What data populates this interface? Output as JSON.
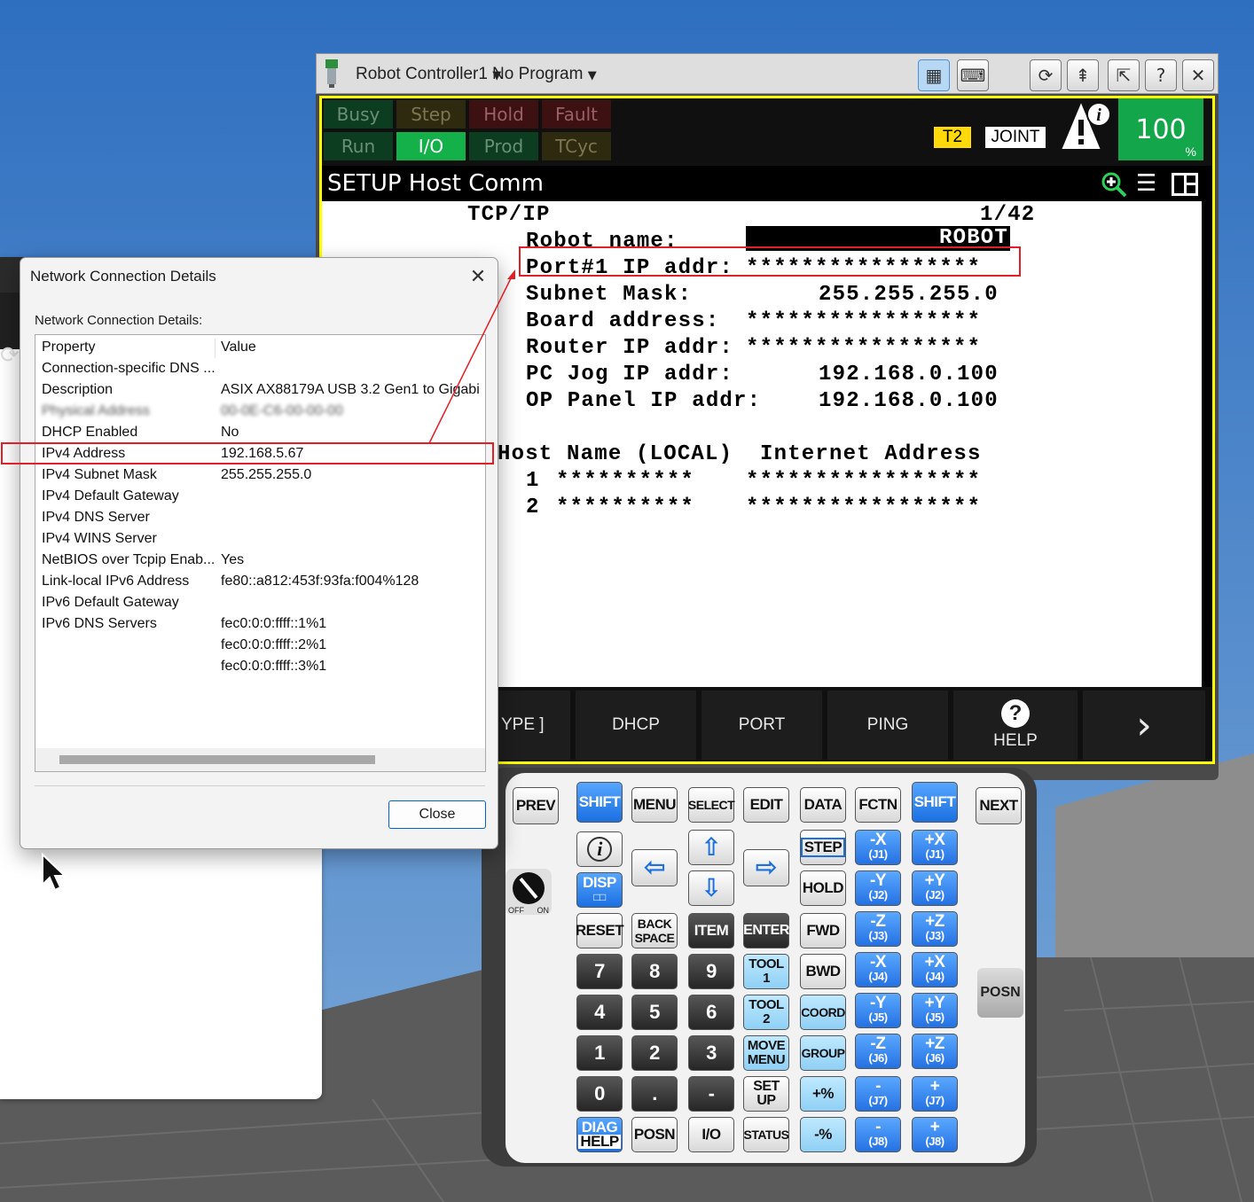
{
  "pendant": {
    "title_bar": {
      "controller_name": "Robot Controller1",
      "program_name": "No Program"
    },
    "status_leds": {
      "row1": [
        {
          "label": "Busy",
          "color": "green",
          "on": false
        },
        {
          "label": "Step",
          "color": "yellow",
          "on": false
        },
        {
          "label": "Hold",
          "color": "red",
          "on": false
        },
        {
          "label": "Fault",
          "color": "red",
          "on": false
        }
      ],
      "row2": [
        {
          "label": "Run",
          "color": "green",
          "on": false
        },
        {
          "label": "I/O",
          "color": "green",
          "on": true
        },
        {
          "label": "Prod",
          "color": "green",
          "on": false
        },
        {
          "label": "TCyc",
          "color": "yellow",
          "on": false
        }
      ]
    },
    "mode": "T2",
    "coord": "JOINT",
    "override": {
      "value": "100",
      "unit": "%"
    },
    "screen_title": "SETUP Host Comm",
    "content": {
      "section": "TCP/IP",
      "page": "1/42",
      "robot_name_label": "Robot name:",
      "robot_name_value": "ROBOT",
      "port1_label": "Port#1 IP addr:",
      "port1_value": "*****************",
      "subnet_label": "Subnet Mask:",
      "subnet_value": "255.255.255.0",
      "board_label": "Board address:",
      "board_value": "*****************",
      "router_label": "Router IP addr:",
      "router_value": "*****************",
      "pcjog_label": "PC Jog IP addr:",
      "pcjog_value": "192.168.0.100",
      "oppanel_label": "OP Panel IP addr:",
      "oppanel_value": "192.168.0.100",
      "host_header_name": "Host Name (LOCAL)",
      "host_header_addr": "Internet Address",
      "hosts": [
        {
          "num": "1",
          "name": "**********",
          "addr": "*****************"
        },
        {
          "num": "2",
          "name": "**********",
          "addr": "*****************"
        }
      ]
    },
    "function_keys": [
      "YPE ]",
      "DHCP",
      "PORT",
      "PING",
      "HELP"
    ],
    "keypad": {
      "prev": "PREV",
      "shift": "SHIFT",
      "menu": "MENU",
      "select": "SELECT",
      "edit": "EDIT",
      "data": "DATA",
      "fctn": "FCTN",
      "next": "NEXT",
      "disp": "DISP",
      "reset": "RESET",
      "back": "BACK",
      "space": "SPACE",
      "item": "ITEM",
      "enter": "ENTER",
      "step": "STEP",
      "hold": "HOLD",
      "fwd": "FWD",
      "bwd": "BWD",
      "coord": "COORD",
      "group": "GROUP",
      "tool": "TOOL",
      "move": "MOVE",
      "menu2": "MENU",
      "set": "SET",
      "up": "UP",
      "diag": "DIAG",
      "help": "HELP",
      "posn": "POSN",
      "io": "I/O",
      "status": "STATUS",
      "plus_pct": "+%",
      "minus_pct": "-%",
      "digits": [
        "7",
        "8",
        "9",
        "4",
        "5",
        "6",
        "1",
        "2",
        "3",
        "0",
        ".",
        "-"
      ],
      "jog": [
        {
          "m": "-X",
          "j": "(J1)"
        },
        {
          "m": "+X",
          "j": "(J1)"
        },
        {
          "m": "-Y",
          "j": "(J2)"
        },
        {
          "m": "+Y",
          "j": "(J2)"
        },
        {
          "m": "-Z",
          "j": "(J3)"
        },
        {
          "m": "+Z",
          "j": "(J3)"
        },
        {
          "m": "-X",
          "j": "(J4)"
        },
        {
          "m": "+X",
          "j": "(J4)"
        },
        {
          "m": "-Y",
          "j": "(J5)"
        },
        {
          "m": "+Y",
          "j": "(J5)"
        },
        {
          "m": "-Z",
          "j": "(J6)"
        },
        {
          "m": "+Z",
          "j": "(J6)"
        },
        {
          "m": "-",
          "j": "(J7)"
        },
        {
          "m": "+",
          "j": "(J7)"
        },
        {
          "m": "-",
          "j": "(J8)"
        },
        {
          "m": "+",
          "j": "(J8)"
        }
      ],
      "tool1": "1",
      "tool2": "2",
      "side_posn": "POSN",
      "deadman_off": "OFF",
      "deadman_on": "ON"
    }
  },
  "dialog": {
    "title": "Network Connection Details",
    "label": "Network Connection Details:",
    "columns": {
      "property": "Property",
      "value": "Value"
    },
    "rows": [
      {
        "property": "Connection-specific DNS ...",
        "value": ""
      },
      {
        "property": "Description",
        "value": "ASIX AX88179A USB 3.2 Gen1 to Gigabi"
      },
      {
        "property": "Physical Address",
        "value": "00-0E-C6-00-00-00"
      },
      {
        "property": "DHCP Enabled",
        "value": "No"
      },
      {
        "property": "IPv4 Address",
        "value": "192.168.5.67"
      },
      {
        "property": "IPv4 Subnet Mask",
        "value": "255.255.255.0"
      },
      {
        "property": "IPv4 Default Gateway",
        "value": ""
      },
      {
        "property": "IPv4 DNS Server",
        "value": ""
      },
      {
        "property": "IPv4 WINS Server",
        "value": ""
      },
      {
        "property": "NetBIOS over Tcpip Enab...",
        "value": "Yes"
      },
      {
        "property": "Link-local IPv6 Address",
        "value": "fe80::a812:453f:93fa:f004%128"
      },
      {
        "property": "IPv6 Default Gateway",
        "value": ""
      },
      {
        "property": "IPv6 DNS Servers",
        "value": "fec0:0:0:ffff::1%1"
      },
      {
        "property": "",
        "value": "fec0:0:0:ffff::2%1"
      },
      {
        "property": "",
        "value": "fec0:0:0:ffff::3%1"
      }
    ],
    "close_label": "Close"
  },
  "colors": {
    "annotation_red": "#e41e26",
    "screen_border_yellow": "#ffff00",
    "led_green_on": "#14b04a",
    "shift_blue": "#1b6fe0"
  }
}
